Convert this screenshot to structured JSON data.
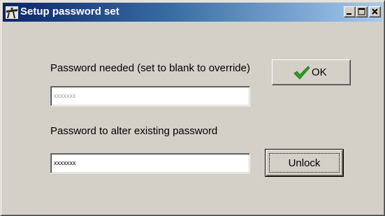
{
  "window": {
    "title": "Setup password set",
    "app_icon": "tools-icon",
    "controls": {
      "minimize": "minimize-icon",
      "maximize": "maximize-icon",
      "close": "close-icon"
    }
  },
  "form": {
    "password_needed_label": "Password needed (set to blank to override)",
    "password_needed_value": "xxxxxxx",
    "alter_password_label": "Password to alter existing password",
    "alter_password_value": "xxxxxxx"
  },
  "buttons": {
    "ok_label": "OK",
    "ok_icon": "checkmark-icon",
    "unlock_label": "Unlock"
  },
  "colors": {
    "title_start": "#0a246a",
    "title_end": "#a6caf0",
    "face": "#d4d0c8",
    "check_green": "#2e9e1a"
  }
}
